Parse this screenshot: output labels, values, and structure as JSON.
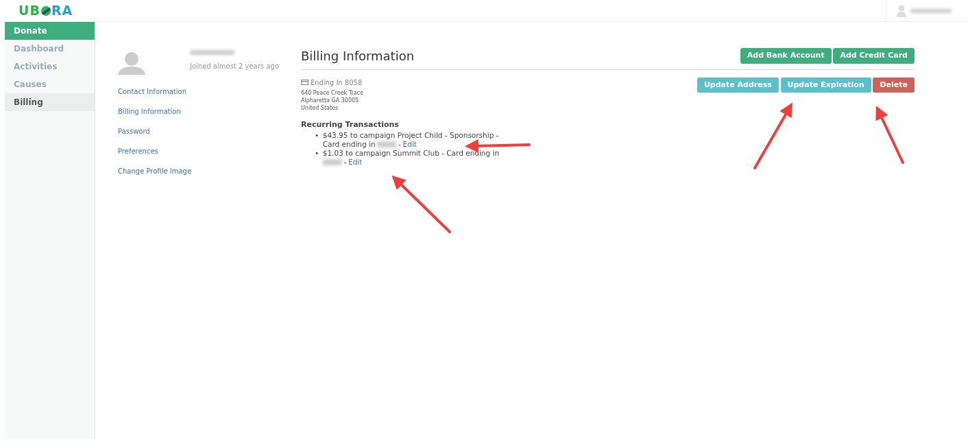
{
  "logo": {
    "parts": [
      "UB",
      "RA"
    ]
  },
  "sidebar": {
    "items": [
      {
        "label": "Donate",
        "kind": "primary",
        "selected": false
      },
      {
        "label": "Dashboard",
        "kind": "link",
        "selected": false
      },
      {
        "label": "Activities",
        "kind": "link",
        "selected": false
      },
      {
        "label": "Causes",
        "kind": "link",
        "selected": false
      },
      {
        "label": "Billing",
        "kind": "link",
        "selected": true
      }
    ]
  },
  "profile": {
    "joined": "Joined almost 2 years ago",
    "links": [
      "Contact Information",
      "Billing Information",
      "Password",
      "Preferences",
      "Change Profile Image"
    ]
  },
  "billing": {
    "title": "Billing Information",
    "header_buttons": [
      {
        "label": "Add Bank Account",
        "kind": "success"
      },
      {
        "label": "Add Credit Card",
        "kind": "success"
      }
    ],
    "card": {
      "ending": "Ending In 8058",
      "address": [
        "640 Peace Creek Trace",
        "Alpharetta GA 30005",
        "United States"
      ],
      "buttons": [
        {
          "label": "Update Address",
          "kind": "info"
        },
        {
          "label": "Update Expiration",
          "kind": "info"
        },
        {
          "label": "Delete",
          "kind": "danger"
        }
      ]
    },
    "recurring": {
      "title": "Recurring Transactions",
      "items": [
        {
          "bullet": "•",
          "line1": "$43.95 to campaign Project Child - Sponsorship -",
          "line2": "Card ending in",
          "separator": "-",
          "link": "Edit"
        },
        {
          "bullet": "•",
          "line1": "$1.03 to campaign Summit Club - Card ending in",
          "separator": "-",
          "link": "Edit"
        }
      ]
    }
  }
}
